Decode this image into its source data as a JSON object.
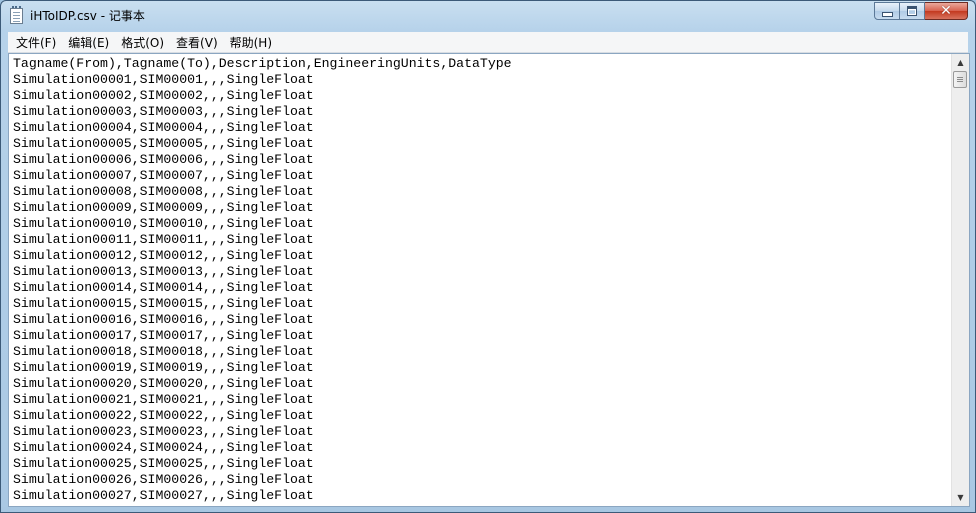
{
  "window": {
    "title": "iHToIDP.csv - 记事本",
    "icon": "notepad-icon"
  },
  "caption_buttons": {
    "minimize_icon": "minimize-icon",
    "maximize_icon": "maximize-icon",
    "close_icon": "close-icon",
    "close_glyph": "✕",
    "close_color": "#c3391f"
  },
  "menubar": {
    "items": [
      {
        "label": "文件(F)"
      },
      {
        "label": "编辑(E)"
      },
      {
        "label": "格式(O)"
      },
      {
        "label": "查看(V)"
      },
      {
        "label": "帮助(H)"
      }
    ]
  },
  "editor": {
    "lines": [
      "Tagname(From),Tagname(To),Description,EngineeringUnits,DataType",
      "Simulation00001,SIM00001,,,SingleFloat",
      "Simulation00002,SIM00002,,,SingleFloat",
      "Simulation00003,SIM00003,,,SingleFloat",
      "Simulation00004,SIM00004,,,SingleFloat",
      "Simulation00005,SIM00005,,,SingleFloat",
      "Simulation00006,SIM00006,,,SingleFloat",
      "Simulation00007,SIM00007,,,SingleFloat",
      "Simulation00008,SIM00008,,,SingleFloat",
      "Simulation00009,SIM00009,,,SingleFloat",
      "Simulation00010,SIM00010,,,SingleFloat",
      "Simulation00011,SIM00011,,,SingleFloat",
      "Simulation00012,SIM00012,,,SingleFloat",
      "Simulation00013,SIM00013,,,SingleFloat",
      "Simulation00014,SIM00014,,,SingleFloat",
      "Simulation00015,SIM00015,,,SingleFloat",
      "Simulation00016,SIM00016,,,SingleFloat",
      "Simulation00017,SIM00017,,,SingleFloat",
      "Simulation00018,SIM00018,,,SingleFloat",
      "Simulation00019,SIM00019,,,SingleFloat",
      "Simulation00020,SIM00020,,,SingleFloat",
      "Simulation00021,SIM00021,,,SingleFloat",
      "Simulation00022,SIM00022,,,SingleFloat",
      "Simulation00023,SIM00023,,,SingleFloat",
      "Simulation00024,SIM00024,,,SingleFloat",
      "Simulation00025,SIM00025,,,SingleFloat",
      "Simulation00026,SIM00026,,,SingleFloat",
      "Simulation00027,SIM00027,,,SingleFloat"
    ]
  },
  "scrollbar": {
    "up_arrow": "▲",
    "down_arrow": "▼",
    "up_icon": "scroll-up-arrow-icon",
    "down_icon": "scroll-down-arrow-icon"
  }
}
